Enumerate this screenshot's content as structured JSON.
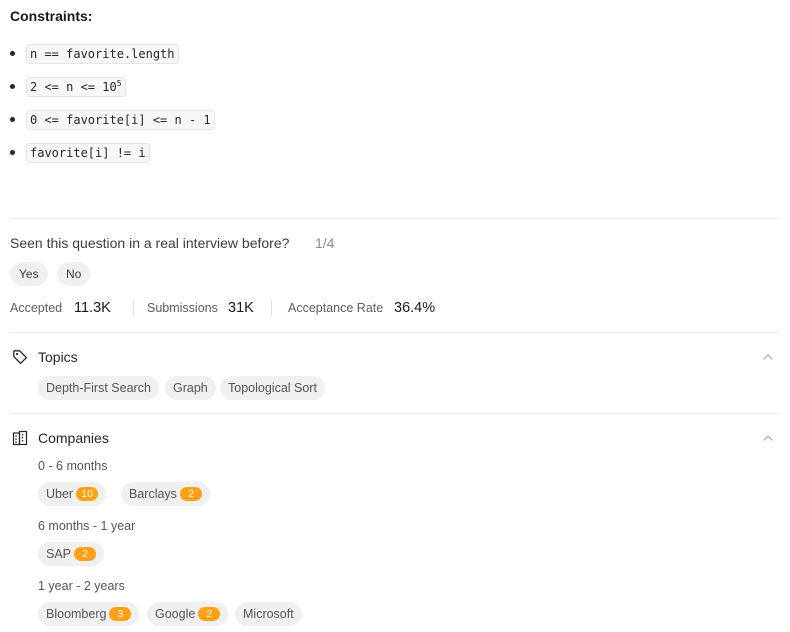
{
  "constraints": {
    "title": "Constraints:",
    "items": [
      {
        "text": "n == favorite.length",
        "sup": ""
      },
      {
        "text": "2 <= n <= 10",
        "sup": "5"
      },
      {
        "text": "0 <= favorite[i] <= n - 1",
        "sup": ""
      },
      {
        "text": "favorite[i] != i",
        "sup": ""
      }
    ]
  },
  "interview": {
    "question": "Seen this question in a real interview before?",
    "count": "1/4",
    "yes_label": "Yes",
    "no_label": "No"
  },
  "stats": {
    "accepted_label": "Accepted",
    "accepted_value": "11.3K",
    "submissions_label": "Submissions",
    "submissions_value": "31K",
    "rate_label": "Acceptance Rate",
    "rate_value": "36.4%"
  },
  "topics": {
    "title": "Topics",
    "icon": "tag-icon",
    "items": [
      "Depth-First Search",
      "Graph",
      "Topological Sort"
    ]
  },
  "companies": {
    "title": "Companies",
    "icon": "building-icon",
    "groups": [
      {
        "period": "0 - 6 months",
        "items": [
          {
            "name": "Uber",
            "count": "10"
          },
          {
            "name": "Barclays",
            "count": "2"
          }
        ]
      },
      {
        "period": "6 months - 1 year",
        "items": [
          {
            "name": "SAP",
            "count": "2"
          }
        ]
      },
      {
        "period": "1 year - 2 years",
        "items": [
          {
            "name": "Bloomberg",
            "count": "3"
          },
          {
            "name": "Google",
            "count": "2"
          },
          {
            "name": "Microsoft",
            "count": ""
          }
        ]
      }
    ]
  },
  "colors": {
    "badge": "#ffa116",
    "pill_bg": "#f0f0f0",
    "divider": "#ececec"
  }
}
